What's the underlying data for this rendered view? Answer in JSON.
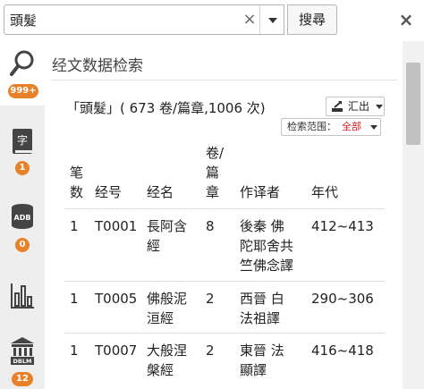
{
  "search": {
    "value": "頭髮",
    "clear_label": "×",
    "button_label": "搜尋",
    "close_label": "×"
  },
  "sidebar": {
    "tabs": [
      {
        "name": "fulltext-search",
        "icon": "magnifier-icon",
        "badge": "999+"
      },
      {
        "name": "dictionary",
        "icon": "dictionary-book-icon",
        "badge": "1"
      },
      {
        "name": "database",
        "icon": "adb-database-icon",
        "badge": "0"
      },
      {
        "name": "statistics",
        "icon": "bar-chart-icon",
        "badge": ""
      },
      {
        "name": "dblm",
        "icon": "dblm-building-icon",
        "badge": "12"
      }
    ]
  },
  "panel": {
    "title": "经文数据检索",
    "summary": "「頭髮」( 673 卷/篇章,1006 次)",
    "export_label": "汇出",
    "scope_label": "检索范围：",
    "scope_value": "全部"
  },
  "table": {
    "headers": {
      "count": [
        "笔",
        "数"
      ],
      "sutra_no": "经号",
      "sutra_name": "经名",
      "juan": [
        "卷/",
        "篇",
        "章"
      ],
      "translator": "作译者",
      "era": "年代"
    },
    "rows": [
      {
        "count": "1",
        "sutra_no": "T0001",
        "sutra_name": [
          "長阿含",
          "經"
        ],
        "juan": "8",
        "translator": [
          "後秦 佛",
          "陀耶舍共",
          "竺佛念譯"
        ],
        "era": "412~413"
      },
      {
        "count": "1",
        "sutra_no": "T0005",
        "sutra_name": [
          "佛般泥",
          "洹經"
        ],
        "juan": "2",
        "translator": [
          "西晉 白",
          "法祖譯"
        ],
        "era": "290~306"
      },
      {
        "count": "1",
        "sutra_no": "T0007",
        "sutra_name": [
          "大般涅",
          "槃經"
        ],
        "juan": "2",
        "translator": [
          "東晉 法",
          "顯譯"
        ],
        "era": "416~418"
      }
    ]
  },
  "colors": {
    "badge": "#e8822a",
    "scope_value": "#d42020",
    "sidebar_bg": "#eeeeee"
  }
}
